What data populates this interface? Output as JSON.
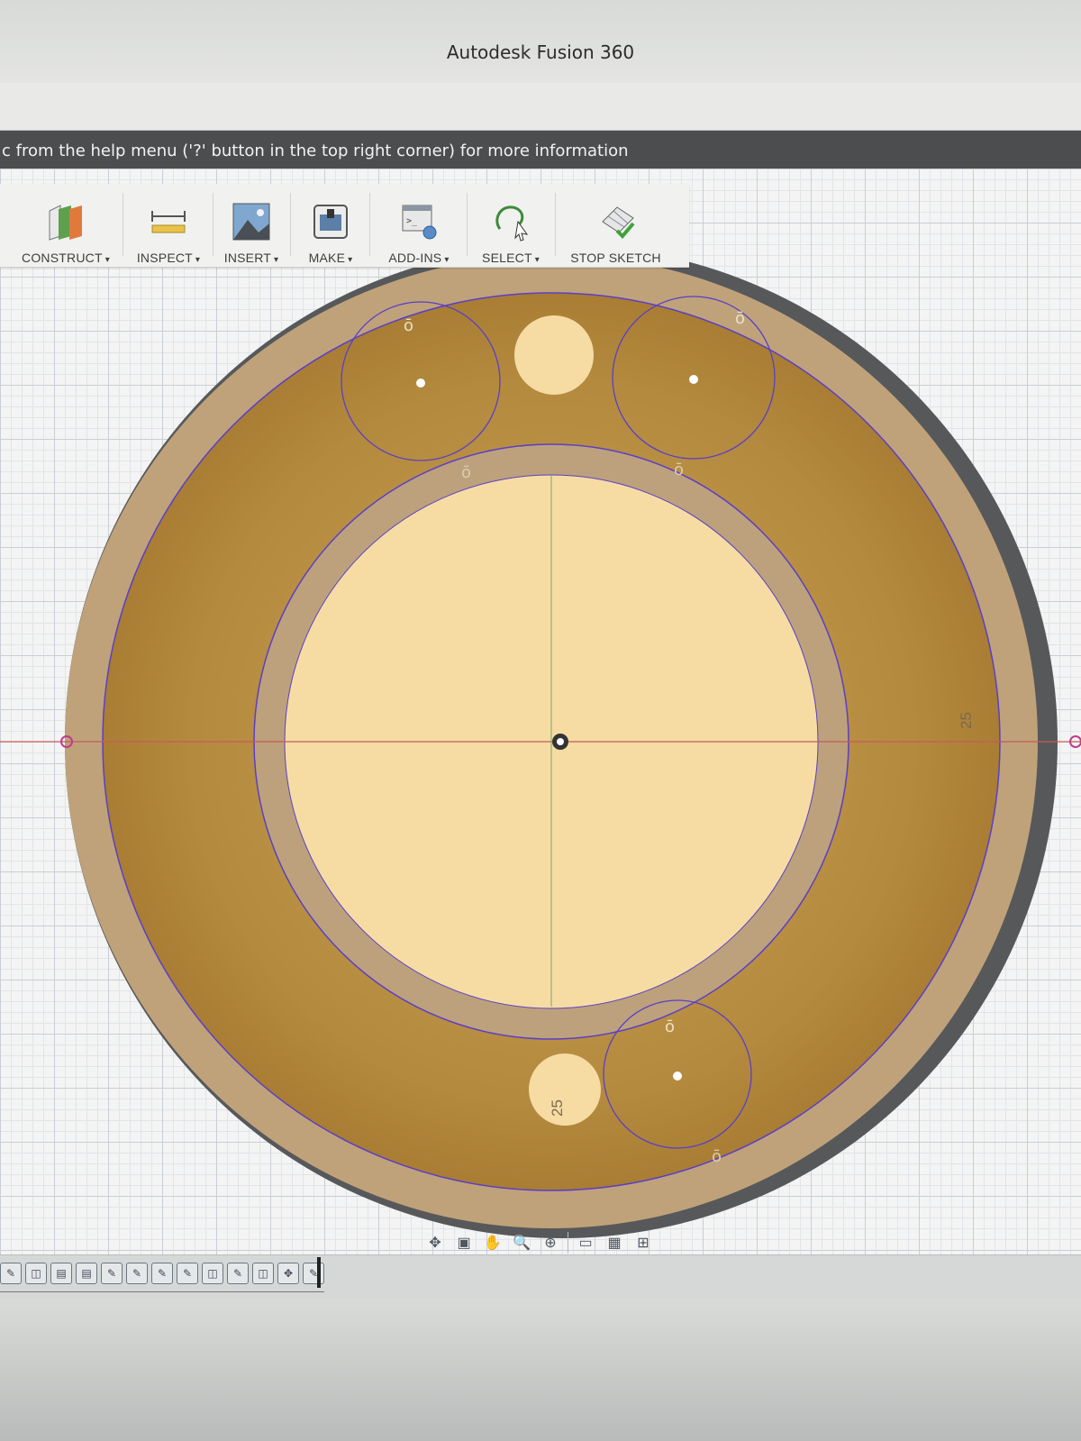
{
  "window": {
    "title": "Autodesk Fusion 360"
  },
  "help_banner": {
    "text": "c from the help menu ('?' button in the top right corner) for more information"
  },
  "toolbar": {
    "construct": "CONSTRUCT",
    "inspect": "INSPECT",
    "insert": "INSERT",
    "make": "MAKE",
    "add_ins": "ADD-INS",
    "select": "SELECT",
    "stop_sketch": "STOP SKETCH"
  },
  "sketch": {
    "dimension_right": "25",
    "dimension_bottom": "25"
  },
  "colors": {
    "profile_dark": "#b0863c",
    "profile_light": "#f6dca3",
    "profile_ring": "#bfa37a",
    "sketch_line": "#5a3fc8",
    "outer_rim": "#555555"
  },
  "navigation_bar": {
    "icons": [
      "orbit-icon",
      "look-at-icon",
      "pan-icon",
      "zoom-icon",
      "fit-icon",
      "display-settings-icon",
      "grid-icon",
      "viewports-icon"
    ]
  },
  "timeline": {
    "icons": [
      "sketch-icon",
      "extrude-icon",
      "body-icon",
      "body-icon",
      "sketch-icon",
      "sketch-icon",
      "sketch-icon",
      "sketch-icon",
      "extrude-icon",
      "sketch-icon",
      "extrude-icon",
      "move-icon",
      "sketch-icon"
    ]
  }
}
